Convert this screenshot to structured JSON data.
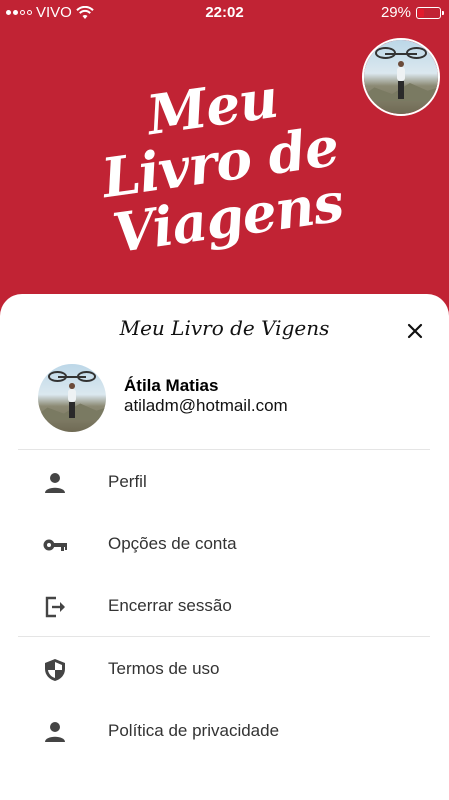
{
  "status_bar": {
    "carrier": "VIVO",
    "time": "22:02",
    "battery_percent": "29%",
    "battery_level": 0.29
  },
  "header": {
    "logo_text": "Meu Livro de Viagens"
  },
  "drawer": {
    "title": "Meu Livro de Vigens",
    "close_icon": "close-icon",
    "user": {
      "name": "Átila Matias",
      "email": "atiladm@hotmail.com"
    },
    "menu_group_1": [
      {
        "label": "Perfil",
        "icon": "person-icon"
      },
      {
        "label": "Opções de conta",
        "icon": "key-icon"
      },
      {
        "label": "Encerrar sessão",
        "icon": "logout-icon"
      }
    ],
    "menu_group_2": [
      {
        "label": "Termos de uso",
        "icon": "shield-icon"
      },
      {
        "label": "Política de privacidade",
        "icon": "person-icon"
      }
    ]
  },
  "colors": {
    "brand_red": "#c12334",
    "icon_gray": "#444444"
  }
}
